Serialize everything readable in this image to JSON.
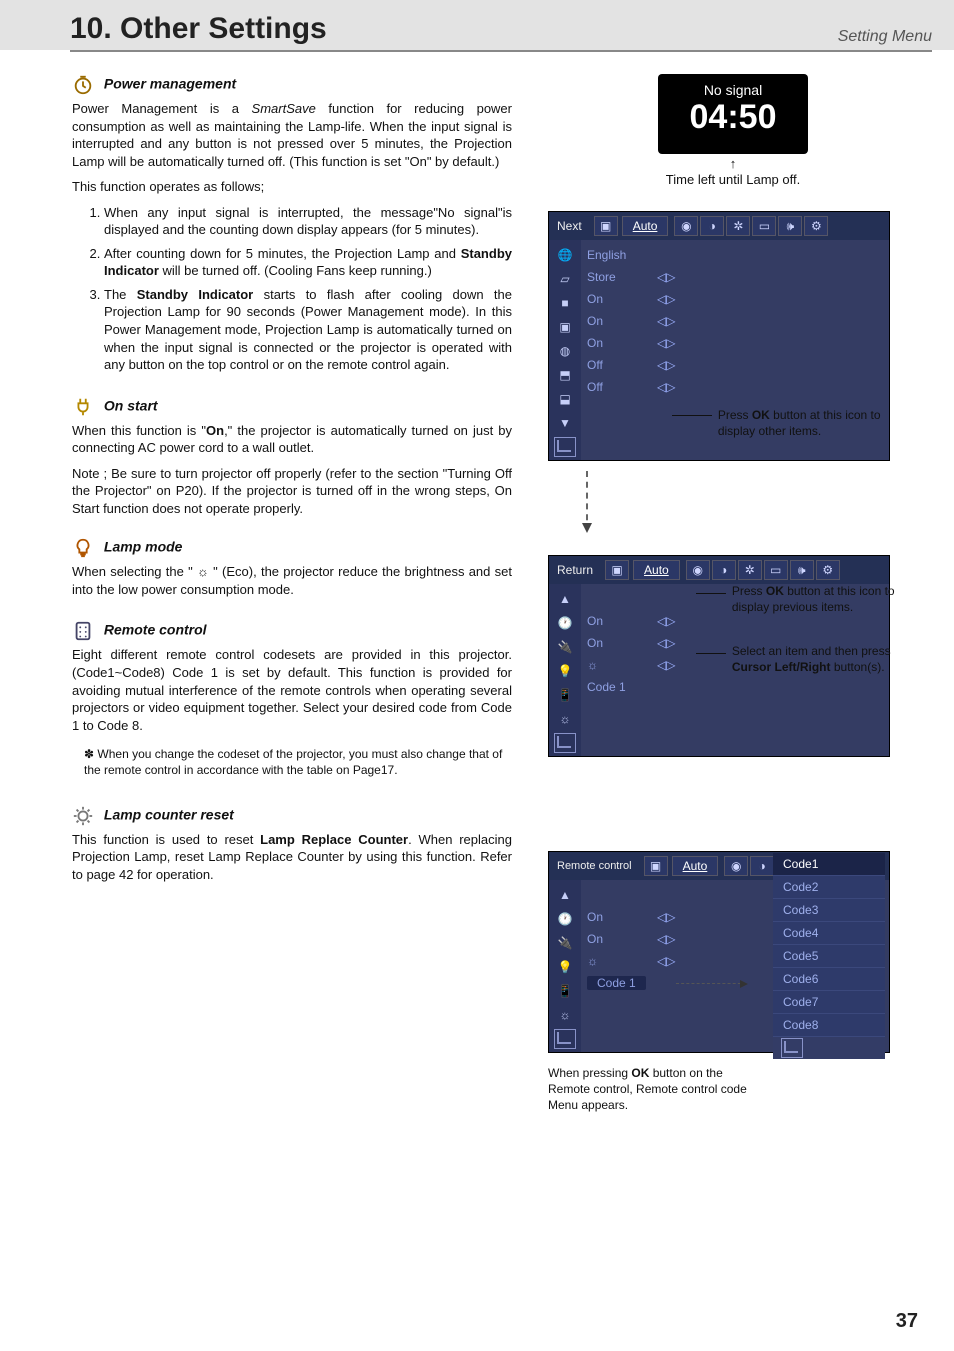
{
  "header": {
    "title": "10. Other Settings",
    "menu": "Setting Menu"
  },
  "sections": {
    "pm": {
      "heading": "Power management",
      "p1_a": "Power Management is a ",
      "p1_b": "SmartSave",
      "p1_c": " function for reducing power consumption as well as maintaining the Lamp-life. When the input signal is interrupted and any button is not pressed over 5 minutes, the Projection Lamp will be automatically turned off.  (This function is set \"On\" by default.)",
      "p2": "This function operates as follows;",
      "s1": "When any input signal is interrupted, the message\"No signal\"is displayed and the counting down display appears (for 5 minutes).",
      "s2": "After counting down for 5 minutes, the Projection Lamp and ",
      "s2b": "Standby Indicator",
      "s2c": " will be turned off.  (Cooling Fans keep running.)",
      "s3a": "The ",
      "s3b": "Standby Indicator",
      "s3c": " starts to flash after cooling down the Projection Lamp for 90 seconds (Power Management mode). In this Power Management mode, Projection Lamp is automatically turned on when the input signal is connected or the projector is operated with any button on the top control or on the remote control again."
    },
    "onstart": {
      "heading": "On start",
      "p1a": "When this function is \"",
      "p1b": "On",
      "p1c": ",\" the projector is automatically turned on just by connecting AC power cord to a wall outlet.",
      "p2": "Note ; Be sure to turn projector off properly (refer to the section \"Turning Off the Projector\" on P20).  If the projector is turned off in the wrong steps, On Start function does not operate properly."
    },
    "lamp": {
      "heading": "Lamp mode",
      "p1": "When selecting the \" ☼ \" (Eco), the projector reduce the brightness and set into the low power consumption mode."
    },
    "remote": {
      "heading": "Remote control",
      "p1": "Eight different remote control codesets are provided in this projector.(Code1~Code8)  Code 1 is set by default. This function is provided for avoiding mutual interference of the remote controls when operating several projectors or video equipment together. Select your desired code from Code 1 to Code 8.",
      "p2": "✽ When you change the codeset of the projector, you must also change that of the remote control in accordance with the table on Page17."
    },
    "reset": {
      "heading": "Lamp counter reset",
      "p1a": "This function is used to reset ",
      "p1b": "Lamp Replace Counter",
      "p1c": ".  When replacing Projection Lamp, reset Lamp Replace Counter by using this function.  Refer to page 42 for operation."
    }
  },
  "timer": {
    "nosig": "No signal",
    "digits": "04:50",
    "caption": "Time left until Lamp off."
  },
  "osd1": {
    "tab_label": "Next",
    "auto": "Auto",
    "rows": [
      {
        "val": "English"
      },
      {
        "val": "Store",
        "ar": true
      },
      {
        "val": "On",
        "ar": true
      },
      {
        "val": "On",
        "ar": true
      },
      {
        "val": "On",
        "ar": true
      },
      {
        "val": "Off",
        "ar": true
      },
      {
        "val": "Off",
        "ar": true
      }
    ],
    "anno_a": "Press ",
    "anno_b": "OK",
    "anno_c": " button at this icon to display other items."
  },
  "osd2": {
    "tab_label": "Return",
    "auto": "Auto",
    "rows": [
      {
        "val": "On",
        "ar": true
      },
      {
        "val": "On",
        "ar": true
      },
      {
        "val": "☼",
        "ar": true
      },
      {
        "val": "Code 1"
      }
    ],
    "anno1a": "Press ",
    "anno1b": "OK",
    "anno1c": " button at this icon to display previous items.",
    "anno2a": "Select an item and then press ",
    "anno2b": "Cursor Left/Right",
    "anno2c": " button(s)."
  },
  "osd3": {
    "tab_label": "Remote control",
    "auto": "Auto",
    "rows": [
      {
        "val": "On",
        "ar": true
      },
      {
        "val": "On",
        "ar": true
      },
      {
        "val": "☼",
        "ar": true
      },
      {
        "val": "Code 1",
        "sel": true
      }
    ],
    "codes": [
      "Code1",
      "Code2",
      "Code3",
      "Code4",
      "Code5",
      "Code6",
      "Code7",
      "Code8"
    ],
    "caption_a": "When pressing ",
    "caption_b": "OK",
    "caption_c": " button on the Remote control, Remote control code Menu appears."
  },
  "page": "37"
}
